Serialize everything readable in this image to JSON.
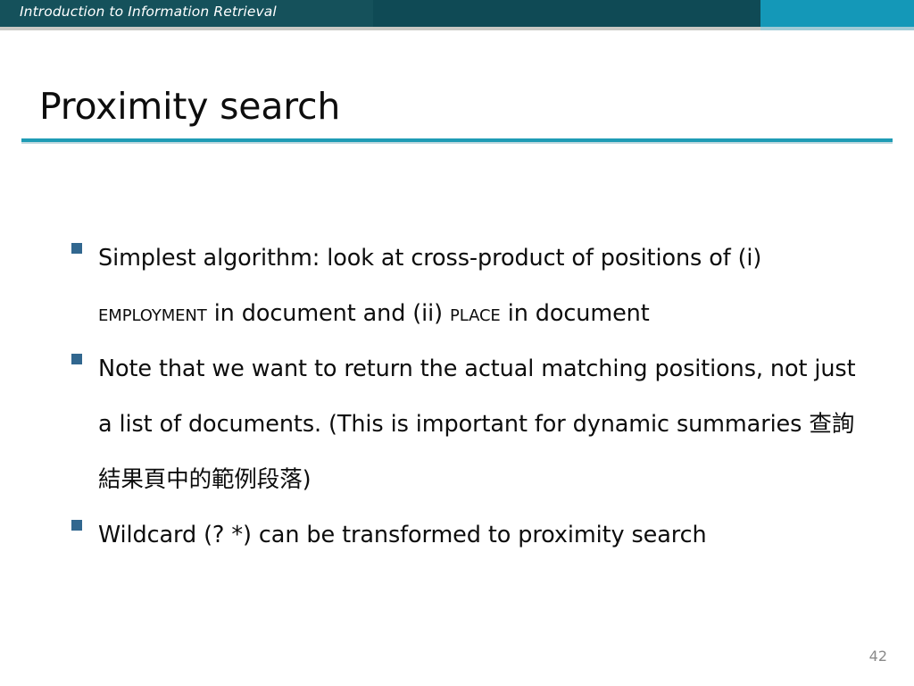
{
  "banner": {
    "title": "Introduction to Information Retrieval",
    "dark_color": "#0f4a55",
    "accent_color": "#1498b8"
  },
  "slide": {
    "title": "Proximity search",
    "rule_color": "#1f9cb5",
    "page_number": "42"
  },
  "bullets": [
    {
      "marker": "square-bullet",
      "segments": [
        {
          "type": "normal",
          "text": "Simplest algorithm: look at cross-product of positions of (i) "
        },
        {
          "type": "smallcaps",
          "text": "Employment"
        },
        {
          "type": "normal",
          "text": " in document and (ii) "
        },
        {
          "type": "smallcaps",
          "text": "Place"
        },
        {
          "type": "normal",
          "text": " in document"
        }
      ],
      "plain": "Simplest algorithm: look at cross-product of positions of (i) EMPLOYMENT in document and (ii) PLACE in document"
    },
    {
      "marker": "square-bullet",
      "segments": [
        {
          "type": "normal",
          "text": "Note that we want to return the actual matching positions, not just a list of documents. (This is important for dynamic summaries "
        },
        {
          "type": "cjk",
          "text": "查詢結果頁中的範例段落"
        },
        {
          "type": "normal",
          "text": ")"
        }
      ],
      "plain": "Note that we want to return the actual matching positions, not just a list of documents. (This is important for dynamic summaries 查詢結果頁中的範例段落)"
    },
    {
      "marker": "square-bullet",
      "segments": [
        {
          "type": "normal",
          "text": "Wildcard (? *) can be transformed to proximity search"
        }
      ],
      "plain": "Wildcard (? *) can be transformed to proximity search"
    }
  ],
  "bullet_color": "#31678f"
}
